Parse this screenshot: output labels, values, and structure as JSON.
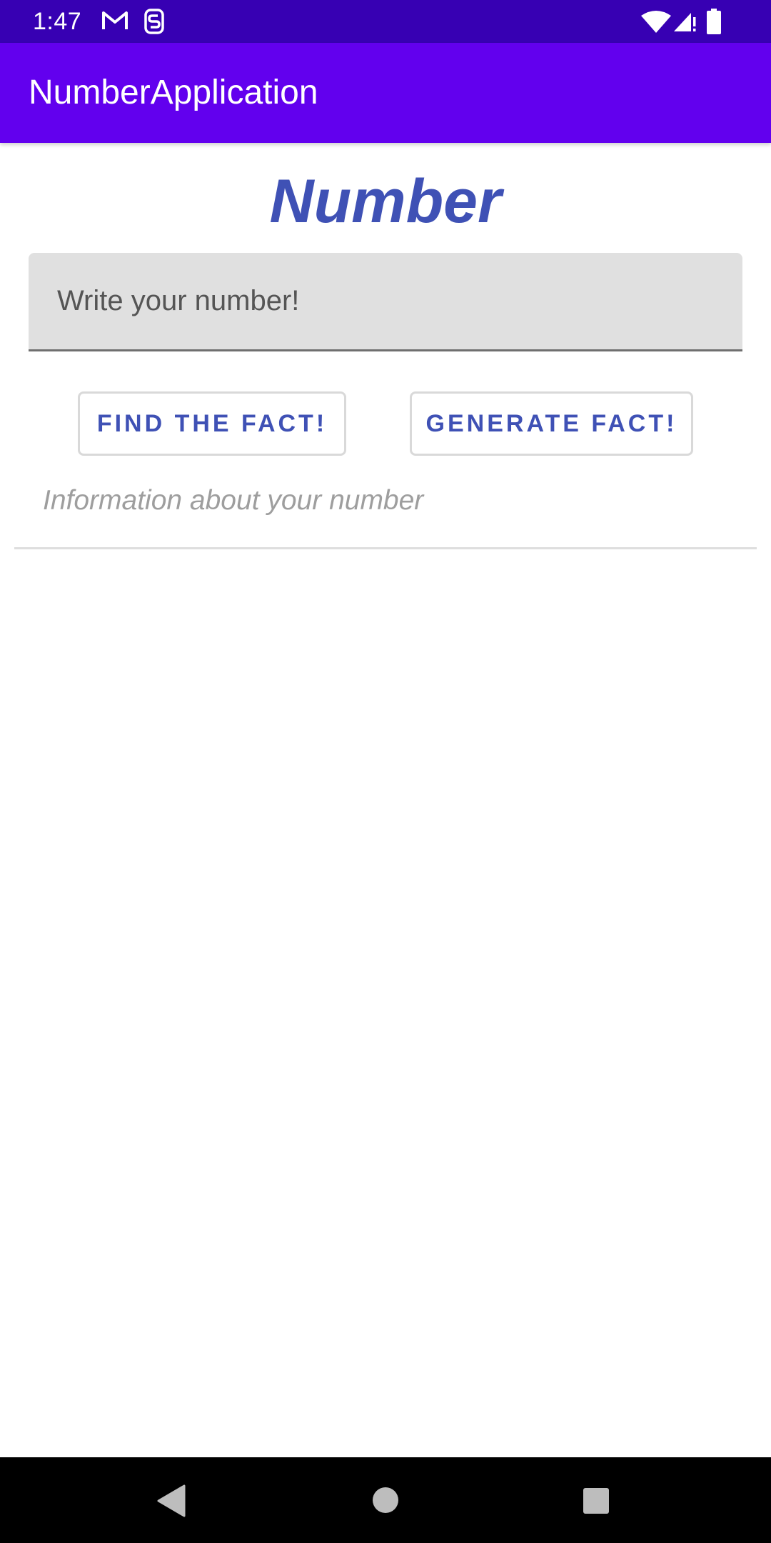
{
  "status_bar": {
    "time": "1:47",
    "icons": [
      "gmail-icon",
      "s-notification-icon",
      "wifi-icon",
      "signal-icon",
      "battery-icon"
    ]
  },
  "app_bar": {
    "title": "NumberApplication"
  },
  "main": {
    "heading": "Number",
    "input": {
      "placeholder": "Write your number!",
      "value": ""
    },
    "buttons": {
      "find_label": "Find the fact!",
      "generate_label": "Generate fact!"
    },
    "info_text": "Information about your number"
  },
  "nav_bar": {
    "icons": [
      "back-icon",
      "home-icon",
      "recents-icon"
    ]
  },
  "colors": {
    "status_bar": "#3700b3",
    "app_bar": "#6200ee",
    "accent": "#3f51b5",
    "input_bg": "#e0e0e0",
    "hint_text": "#9e9e9e"
  }
}
